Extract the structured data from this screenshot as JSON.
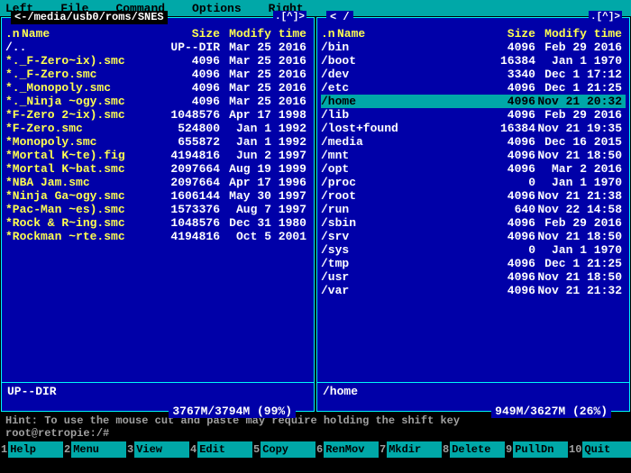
{
  "menubar": [
    "Left",
    "File",
    "Command",
    "Options",
    "Right"
  ],
  "left_panel": {
    "path": "<-/media/usb0/roms/SNES",
    "corner": ".[^]>",
    "headers": {
      "n": ".n",
      "name": "Name",
      "size": "Size",
      "modify": "Modify time"
    },
    "rows": [
      {
        "name": "/..",
        "size": "UP--DIR",
        "mod": "Mar 25  2016",
        "cls": "dir"
      },
      {
        "name": "*._F-Zero~ix).smc",
        "size": "4096",
        "mod": "Mar 25  2016",
        "cls": "tagged"
      },
      {
        "name": "*._F-Zero.smc",
        "size": "4096",
        "mod": "Mar 25  2016",
        "cls": "tagged"
      },
      {
        "name": "*._Monopoly.smc",
        "size": "4096",
        "mod": "Mar 25  2016",
        "cls": "tagged"
      },
      {
        "name": "*._Ninja ~ogy.smc",
        "size": "4096",
        "mod": "Mar 25  2016",
        "cls": "tagged"
      },
      {
        "name": "*F-Zero 2~ix).smc",
        "size": "1048576",
        "mod": "Apr 17  1998",
        "cls": "tagged"
      },
      {
        "name": "*F-Zero.smc",
        "size": "524800",
        "mod": "Jan  1  1992",
        "cls": "tagged"
      },
      {
        "name": "*Monopoly.smc",
        "size": "655872",
        "mod": "Jan  1  1992",
        "cls": "tagged"
      },
      {
        "name": "*Mortal K~te).fig",
        "size": "4194816",
        "mod": "Jun  2  1997",
        "cls": "tagged"
      },
      {
        "name": "*Mortal K~bat.smc",
        "size": "2097664",
        "mod": "Aug 19  1999",
        "cls": "tagged"
      },
      {
        "name": "*NBA Jam.smc",
        "size": "2097664",
        "mod": "Apr 17  1996",
        "cls": "tagged"
      },
      {
        "name": "*Ninja Ga~ogy.smc",
        "size": "1606144",
        "mod": "May 30  1997",
        "cls": "tagged"
      },
      {
        "name": "*Pac-Man ~es).smc",
        "size": "1573376",
        "mod": "Aug  7  1997",
        "cls": "tagged"
      },
      {
        "name": "*Rock & R~ing.smc",
        "size": "1048576",
        "mod": "Dec 31  1980",
        "cls": "tagged"
      },
      {
        "name": "*Rockman ~rte.smc",
        "size": "4194816",
        "mod": "Oct  5  2001",
        "cls": "tagged"
      }
    ],
    "footer": "UP--DIR",
    "stats": "3767M/3794M (99%)"
  },
  "right_panel": {
    "path": "< /",
    "corner": ".[^]>",
    "headers": {
      "n": ".n",
      "name": "Name",
      "size": "Size",
      "modify": "Modify time"
    },
    "rows": [
      {
        "name": "/bin",
        "size": "4096",
        "mod": "Feb 29  2016",
        "cls": "dir"
      },
      {
        "name": "/boot",
        "size": "16384",
        "mod": "Jan  1  1970",
        "cls": "dir"
      },
      {
        "name": "/dev",
        "size": "3340",
        "mod": "Dec  1 17:12",
        "cls": "dir"
      },
      {
        "name": "/etc",
        "size": "4096",
        "mod": "Dec  1 21:25",
        "cls": "dir"
      },
      {
        "name": "/home",
        "size": "4096",
        "mod": "Nov 21 20:32",
        "cls": "dir",
        "selected": true
      },
      {
        "name": "/lib",
        "size": "4096",
        "mod": "Feb 29  2016",
        "cls": "dir"
      },
      {
        "name": "/lost+found",
        "size": "16384",
        "mod": "Nov 21 19:35",
        "cls": "dir"
      },
      {
        "name": "/media",
        "size": "4096",
        "mod": "Dec 16  2015",
        "cls": "dir"
      },
      {
        "name": "/mnt",
        "size": "4096",
        "mod": "Nov 21 18:50",
        "cls": "dir"
      },
      {
        "name": "/opt",
        "size": "4096",
        "mod": "Mar  2  2016",
        "cls": "dir"
      },
      {
        "name": "/proc",
        "size": "0",
        "mod": "Jan  1  1970",
        "cls": "dir"
      },
      {
        "name": "/root",
        "size": "4096",
        "mod": "Nov 21 21:38",
        "cls": "dir"
      },
      {
        "name": "/run",
        "size": "640",
        "mod": "Nov 22 14:58",
        "cls": "dir"
      },
      {
        "name": "/sbin",
        "size": "4096",
        "mod": "Feb 29  2016",
        "cls": "dir"
      },
      {
        "name": "/srv",
        "size": "4096",
        "mod": "Nov 21 18:50",
        "cls": "dir"
      },
      {
        "name": "/sys",
        "size": "0",
        "mod": "Jan  1  1970",
        "cls": "dir"
      },
      {
        "name": "/tmp",
        "size": "4096",
        "mod": "Dec  1 21:25",
        "cls": "dir"
      },
      {
        "name": "/usr",
        "size": "4096",
        "mod": "Nov 21 18:50",
        "cls": "dir"
      },
      {
        "name": "/var",
        "size": "4096",
        "mod": "Nov 21 21:32",
        "cls": "dir"
      }
    ],
    "footer": "/home",
    "stats": "949M/3627M (26%)"
  },
  "hint": "Hint: To use the mouse cut and paste may require holding the shift key",
  "prompt": "root@retropie:/#",
  "fkeys": [
    {
      "num": "1",
      "lbl": "Help"
    },
    {
      "num": "2",
      "lbl": "Menu"
    },
    {
      "num": "3",
      "lbl": "View"
    },
    {
      "num": "4",
      "lbl": "Edit"
    },
    {
      "num": "5",
      "lbl": "Copy"
    },
    {
      "num": "6",
      "lbl": "RenMov"
    },
    {
      "num": "7",
      "lbl": "Mkdir"
    },
    {
      "num": "8",
      "lbl": "Delete"
    },
    {
      "num": "9",
      "lbl": "PullDn"
    },
    {
      "num": "10",
      "lbl": "Quit"
    }
  ]
}
